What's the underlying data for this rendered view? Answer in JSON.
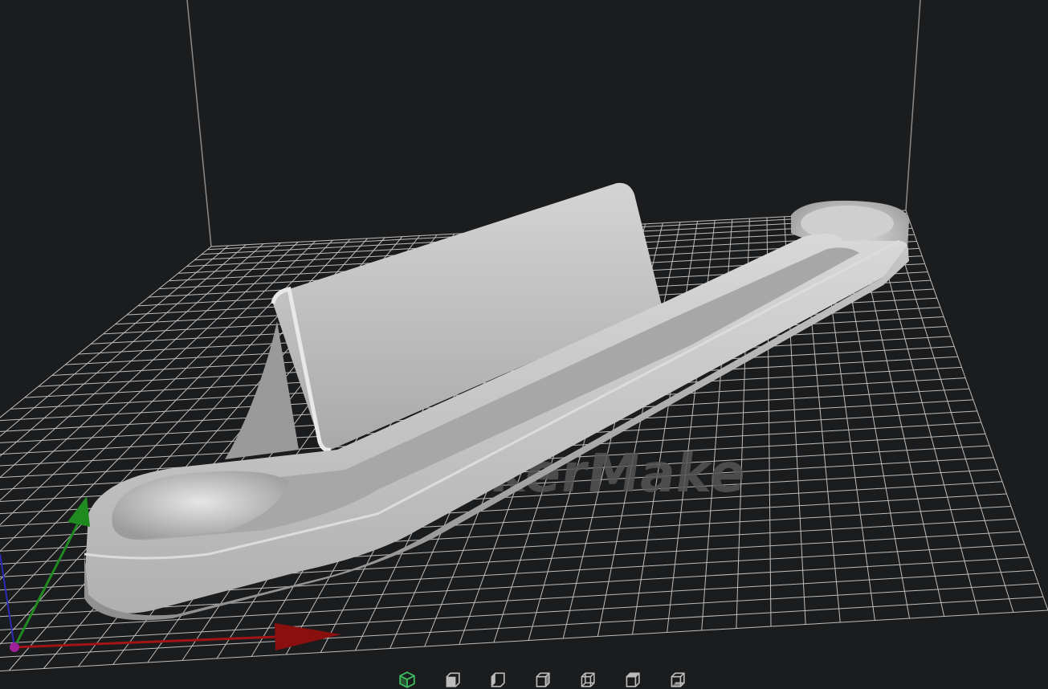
{
  "app": {
    "watermark_text": "kerMake"
  },
  "colors": {
    "background": "#1b1c1e",
    "grid": "#c8c8c8",
    "model": "#b9b9b9",
    "axis_x": "#a31515",
    "axis_y": "#1f8a1f",
    "axis_z": "#2b2bb8",
    "origin": "#a0209a",
    "active_view": "#3fbf5f",
    "view_icon": "#bcbcbc"
  },
  "view_toolbar": {
    "buttons": [
      {
        "icon": "iso-view-icon",
        "active": true
      },
      {
        "icon": "front-view-icon",
        "active": false
      },
      {
        "icon": "left-view-icon",
        "active": false
      },
      {
        "icon": "right-view-icon",
        "active": false
      },
      {
        "icon": "back-view-icon",
        "active": false
      },
      {
        "icon": "top-view-icon",
        "active": false
      },
      {
        "icon": "bottom-view-icon",
        "active": false
      }
    ]
  }
}
